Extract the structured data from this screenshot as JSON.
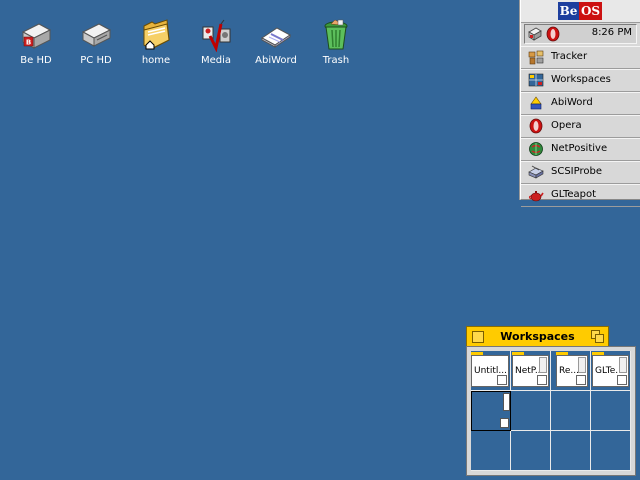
{
  "desktop": {
    "background_color": "#336699",
    "icons": [
      {
        "label": "Be HD",
        "icon": "be-harddisk-icon"
      },
      {
        "label": "PC HD",
        "icon": "pc-harddisk-icon"
      },
      {
        "label": "home",
        "icon": "home-folder-icon"
      },
      {
        "label": "Media",
        "icon": "media-icon"
      },
      {
        "label": "AbiWord",
        "icon": "abiword-document-icon"
      },
      {
        "label": "Trash",
        "icon": "trash-icon"
      }
    ]
  },
  "deskbar": {
    "logo": {
      "be": "Be",
      "os": "OS"
    },
    "tray": {
      "icons": [
        "network-status-icon",
        "opera-tray-icon"
      ],
      "clock": "8:26 PM"
    },
    "apps": [
      {
        "label": "Tracker",
        "icon": "tracker-icon"
      },
      {
        "label": "Workspaces",
        "icon": "workspaces-icon"
      },
      {
        "label": "AbiWord",
        "icon": "abiword-icon"
      },
      {
        "label": "Opera",
        "icon": "opera-icon"
      },
      {
        "label": "NetPositive",
        "icon": "netpositive-icon"
      },
      {
        "label": "SCSIProbe",
        "icon": "scsiprobe-icon"
      },
      {
        "label": "GLTeapot",
        "icon": "glteapot-icon"
      }
    ]
  },
  "workspaces_window": {
    "title": "Workspaces",
    "tab_color": "#ffcb00",
    "mini_windows": [
      {
        "label": "Untitl..."
      },
      {
        "label": "NetP..."
      },
      {
        "label": "Re..."
      },
      {
        "label": "GLTe..."
      }
    ],
    "active_workspace": 5
  }
}
